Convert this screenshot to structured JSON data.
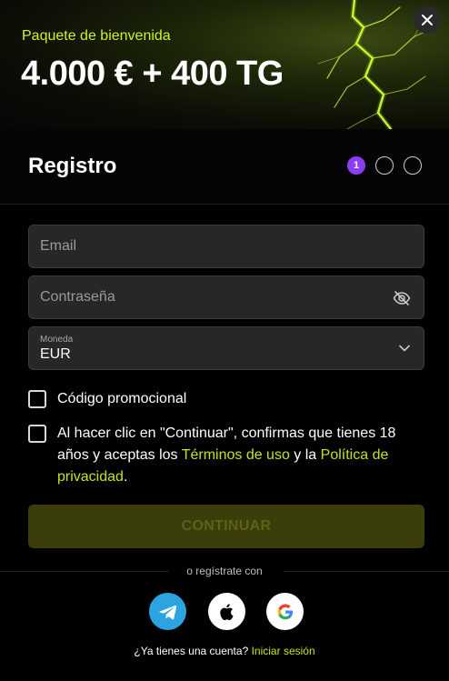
{
  "banner": {
    "subtitle": "Paquete de bienvenida",
    "title": "4.000 € + 400 TG",
    "close_icon": "close-icon"
  },
  "header": {
    "title": "Registro",
    "steps": [
      "1",
      "",
      ""
    ],
    "active_step": 1
  },
  "form": {
    "email": {
      "placeholder": "Email",
      "value": ""
    },
    "password": {
      "placeholder": "Contraseña",
      "value": "",
      "icon": "eye-off-icon"
    },
    "currency": {
      "label": "Moneda",
      "value": "EUR",
      "icon": "chevron-down-icon"
    },
    "promo_label": "Código promocional",
    "terms": {
      "prefix": "Al hacer clic en \"Continuar\", confirmas que tienes 18 años y aceptas los ",
      "terms_link": "Términos de uso",
      "middle": " y la ",
      "privacy_link": "Política de privacidad",
      "suffix": "."
    },
    "continue_label": "CONTINUAR"
  },
  "social": {
    "divider_text": "o regístrate con",
    "providers": [
      "telegram-icon",
      "apple-icon",
      "google-icon"
    ]
  },
  "footer": {
    "question": "¿Ya tienes una cuenta?",
    "login_link": "Iniciar sesión"
  },
  "colors": {
    "accent": "#c6e21b",
    "step_active": "#8b3cf4",
    "button_disabled_bg": "#3b3e0b",
    "telegram": "#2ba4e0"
  }
}
